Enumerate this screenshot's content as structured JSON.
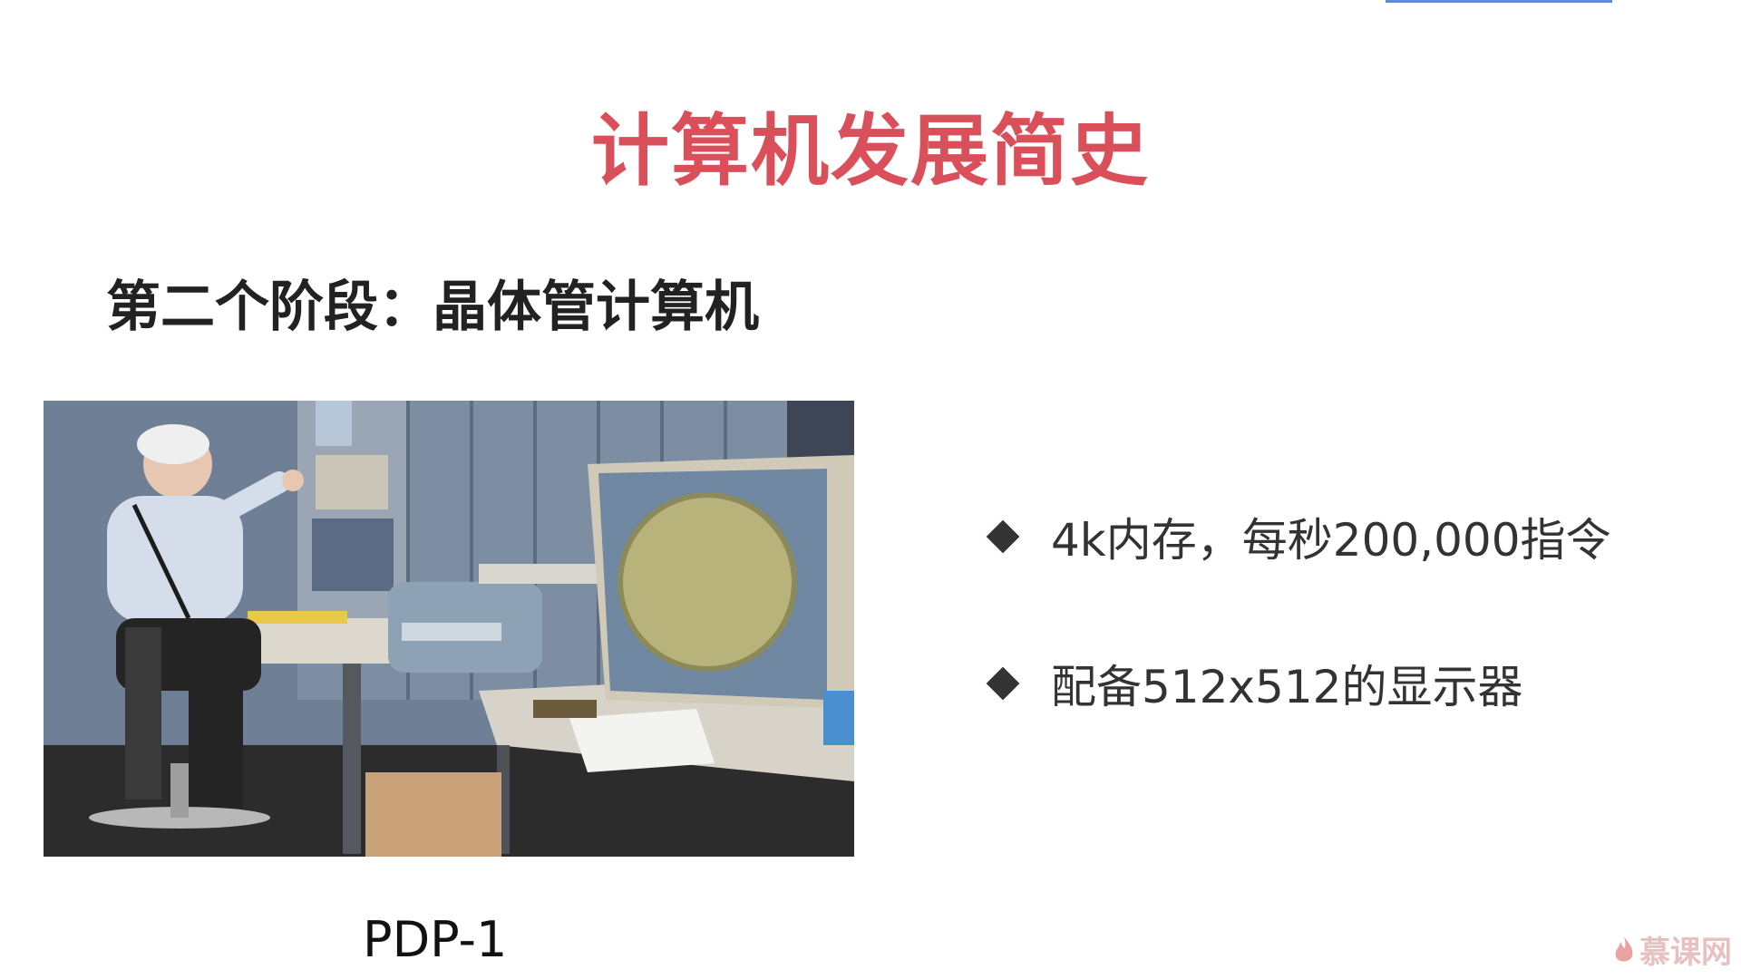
{
  "slide": {
    "title": "计算机发展简史",
    "subtitle": "第二个阶段：晶体管计算机",
    "photo_caption": "PDP-1",
    "bullets": [
      {
        "text": "4k内存，每秒200,000指令"
      },
      {
        "text": "配备512x512的显示器"
      }
    ]
  },
  "watermark": {
    "text": "慕课网"
  },
  "colors": {
    "title": "#d9505a",
    "text": "#333333",
    "accent_bar": "#5b8dd6"
  }
}
